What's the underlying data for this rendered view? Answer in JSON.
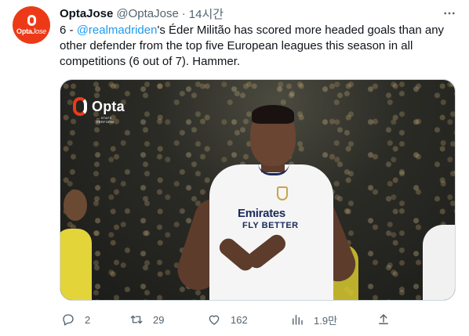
{
  "tweet": {
    "display_name": "OptaJose",
    "handle": "@OptaJose",
    "separator": "·",
    "time": "14시간",
    "text_prefix": "6 - ",
    "mention": "@realmadriden",
    "text_rest": "'s Éder Militão has scored more headed goals than any other defender from the top five European leagues this season in all competitions (6 out of 7). Hammer."
  },
  "avatar": {
    "brand_bold": "Opta",
    "brand_italic": "Jose",
    "color": "#ec3a18"
  },
  "media": {
    "logo_text": "Opta",
    "logo_subtext": "— STATS PERFORM",
    "shirt_sponsor_line1": "Emirates",
    "shirt_sponsor_line2": "FLY BETTER"
  },
  "actions": {
    "reply_count": "2",
    "retweet_count": "29",
    "like_count": "162",
    "views_count": "1.9만"
  },
  "icons": [
    "more-icon",
    "reply-icon",
    "retweet-icon",
    "like-icon",
    "views-icon",
    "share-icon"
  ],
  "colors": {
    "text_primary": "#0f1419",
    "text_secondary": "#536471",
    "link": "#1d9bf0",
    "brand": "#ec3a18"
  }
}
